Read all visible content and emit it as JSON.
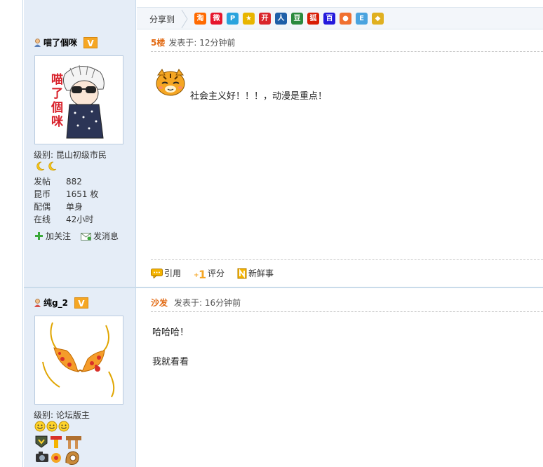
{
  "share": {
    "label": "分享到",
    "icons": [
      {
        "name": "taobao-icon",
        "glyph": "淘",
        "color": "#ff6a00"
      },
      {
        "name": "weibo-icon",
        "glyph": "微",
        "color": "#e6162d"
      },
      {
        "name": "qzone-icon",
        "glyph": "P",
        "color": "#2aa3dd"
      },
      {
        "name": "star-icon",
        "glyph": "★",
        "color": "#e8b500"
      },
      {
        "name": "kaixin-icon",
        "glyph": "开",
        "color": "#d9252b"
      },
      {
        "name": "renren-icon",
        "glyph": "人",
        "color": "#1f5fa8"
      },
      {
        "name": "douban-icon",
        "glyph": "豆",
        "color": "#2b8a3e"
      },
      {
        "name": "sohu-icon",
        "glyph": "狐",
        "color": "#d81e06"
      },
      {
        "name": "baidu-icon",
        "glyph": "百",
        "color": "#2319dc"
      },
      {
        "name": "peach-icon",
        "glyph": "●",
        "color": "#f07030"
      },
      {
        "name": "note-icon",
        "glyph": "E",
        "color": "#4aa3df"
      },
      {
        "name": "yellow-icon",
        "glyph": "◆",
        "color": "#e0b020"
      }
    ]
  },
  "posts": [
    {
      "user": {
        "name": "喵了個咪",
        "vip": "V",
        "level_label": "级别: 昆山初级市民",
        "avatar_text": "喵了個咪",
        "stats": [
          {
            "k": "发帖",
            "v": "882"
          },
          {
            "k": "昆币",
            "v": "1651 枚"
          },
          {
            "k": "配偶",
            "v": "单身"
          },
          {
            "k": "在线",
            "v": "42小时"
          }
        ],
        "follow_label": "加关注",
        "message_label": "发消息"
      },
      "floor": "5楼",
      "posted": "发表于: 12分钟前",
      "body": "社会主义好！！！，动漫是重点！",
      "footer": {
        "quote": "引用",
        "rate": "评分",
        "news": "新鲜事"
      }
    },
    {
      "user": {
        "name": "纯g_2",
        "vip": "V",
        "level_label": "级别: 论坛版主"
      },
      "floor": "沙发",
      "posted": "发表于: 16分钟前",
      "body_lines": [
        "哈哈哈！",
        "我就看看"
      ]
    }
  ]
}
